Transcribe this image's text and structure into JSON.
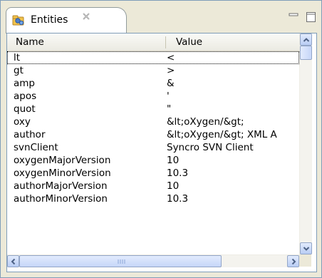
{
  "view": {
    "title": "Entities",
    "icon": "entities-view-icon",
    "close_icon": "close-icon",
    "minimize_icon": "minimize-icon",
    "maximize_icon": "maximize-icon"
  },
  "table": {
    "columns": [
      "Name",
      "Value"
    ],
    "rows": [
      {
        "name": "lt",
        "value": "<"
      },
      {
        "name": "gt",
        "value": ">"
      },
      {
        "name": "amp",
        "value": "&"
      },
      {
        "name": "apos",
        "value": "'"
      },
      {
        "name": "quot",
        "value": "\""
      },
      {
        "name": "oxy",
        "value": "&lt;oXygen/&gt;"
      },
      {
        "name": "author",
        "value": "&lt;oXygen/&gt; XML A"
      },
      {
        "name": "svnClient",
        "value": "Syncro SVN Client"
      },
      {
        "name": "oxygenMajorVersion",
        "value": "10"
      },
      {
        "name": "oxygenMinorVersion",
        "value": "10.3"
      },
      {
        "name": "authorMajorVersion",
        "value": "10"
      },
      {
        "name": "authorMinorVersion",
        "value": "10.3"
      }
    ],
    "selected_row": 0
  },
  "colors": {
    "frame_border": "#7f9db9",
    "chrome_bg": "#ece9d8",
    "scroll_accent": "#b9cdf4"
  }
}
